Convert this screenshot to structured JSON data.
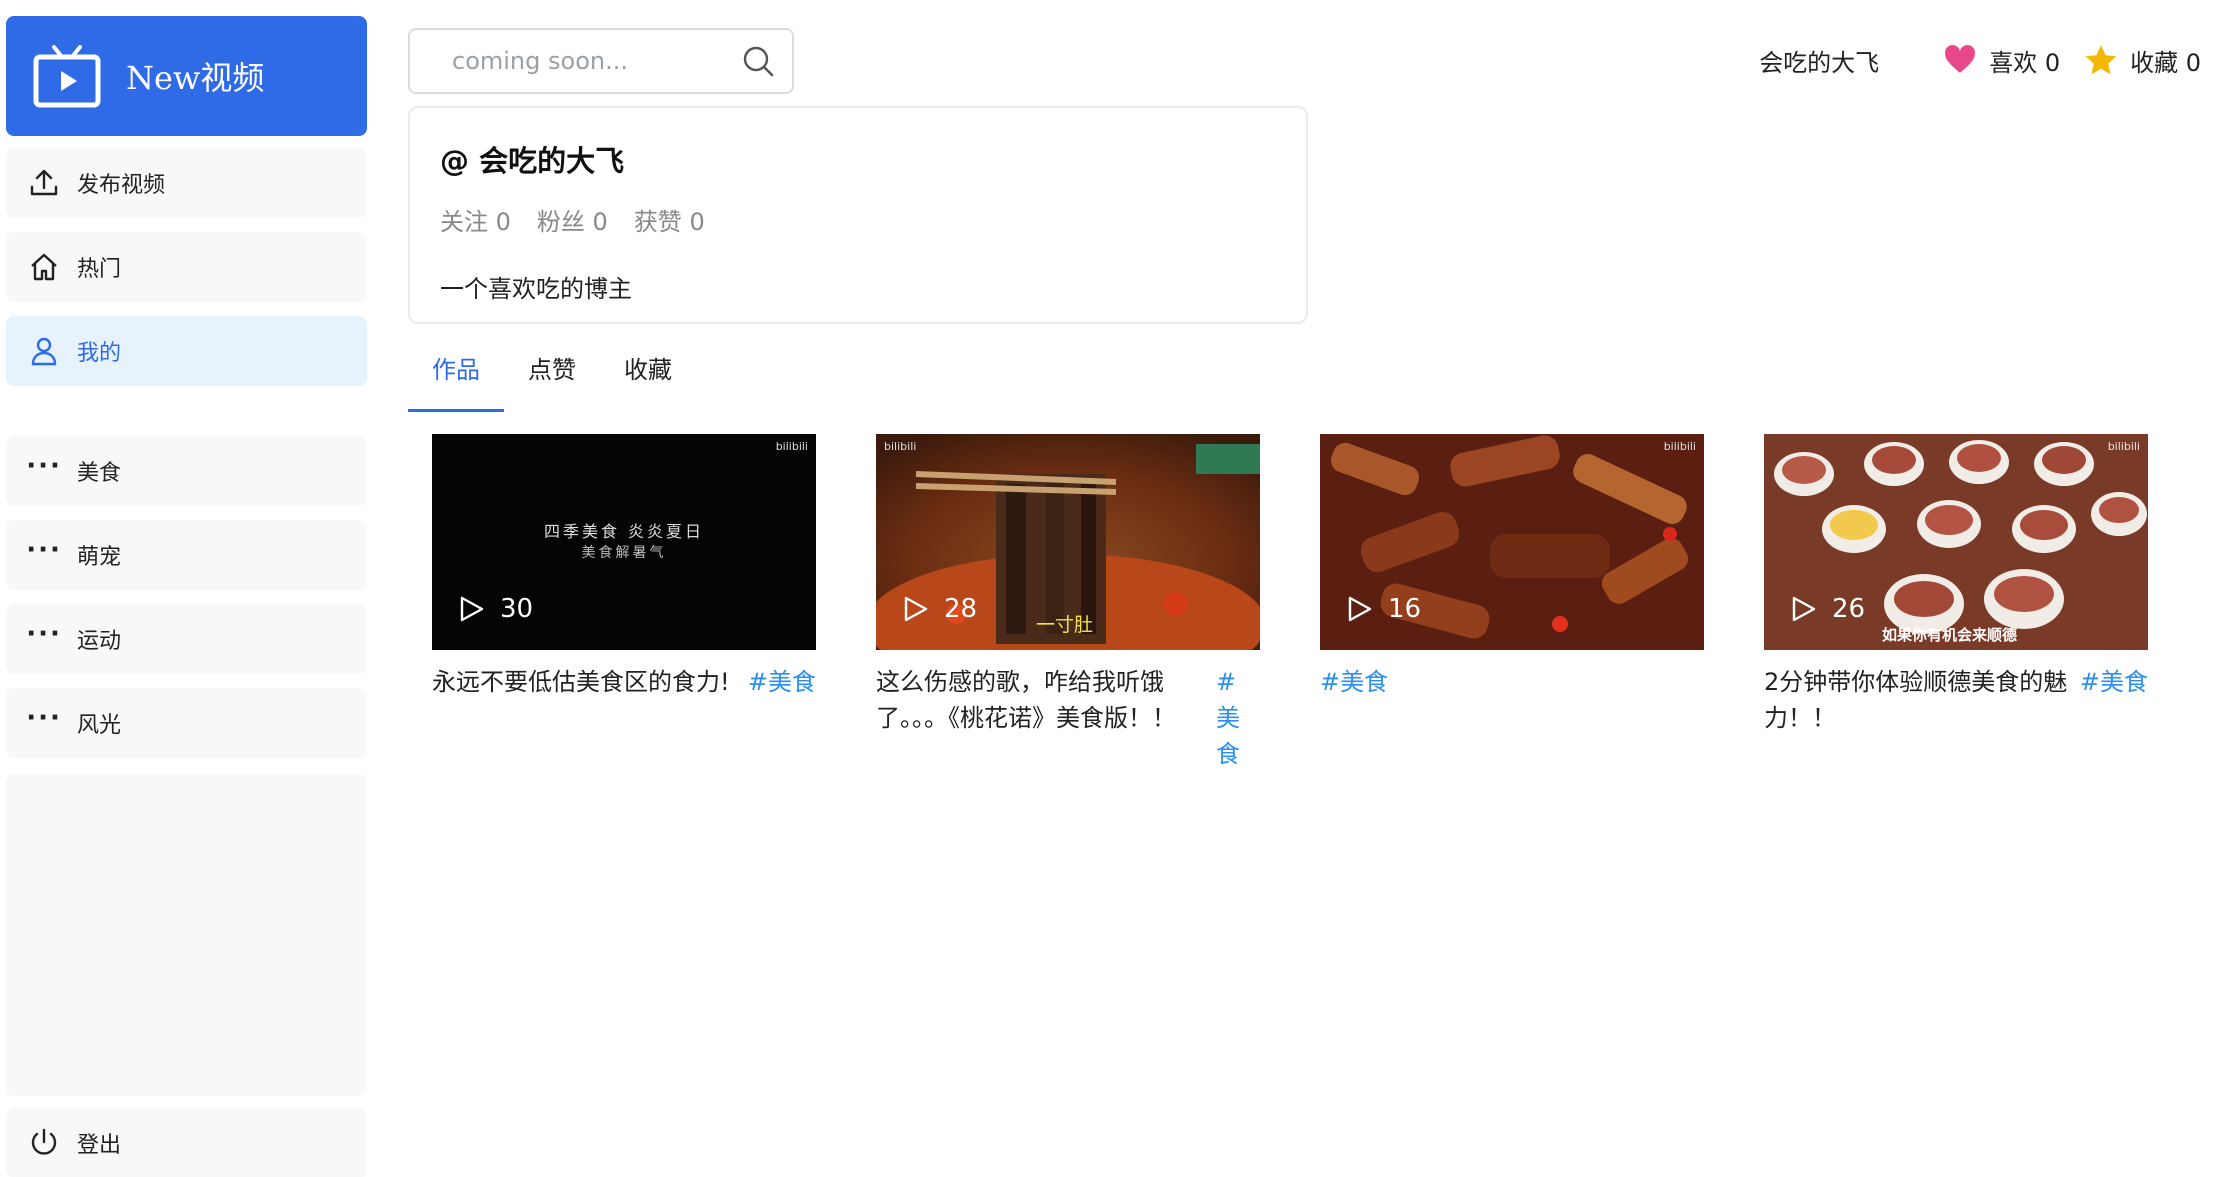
{
  "app": {
    "logo_text": "New视频"
  },
  "sidebar": {
    "items": [
      {
        "label": "发布视频",
        "icon": "upload-icon"
      },
      {
        "label": "热门",
        "icon": "home-icon"
      },
      {
        "label": "我的",
        "icon": "user-icon",
        "active": true
      }
    ],
    "categories": [
      {
        "label": "美食",
        "icon": "more-dots-icon"
      },
      {
        "label": "萌宠",
        "icon": "more-dots-icon"
      },
      {
        "label": "运动",
        "icon": "more-dots-icon"
      },
      {
        "label": "风光",
        "icon": "more-dots-icon"
      }
    ],
    "logout": {
      "label": "登出",
      "icon": "power-icon"
    }
  },
  "search": {
    "placeholder": "coming soon..."
  },
  "header": {
    "username": "会吃的大飞",
    "likes_label": "喜欢 0",
    "favorites_label": "收藏 0"
  },
  "profile": {
    "name": "@ 会吃的大飞",
    "following": "关注 0",
    "followers": "粉丝 0",
    "likes": "获赞 0",
    "bio": "一个喜欢吃的博主"
  },
  "tabs": [
    {
      "label": "作品",
      "active": true
    },
    {
      "label": "点赞"
    },
    {
      "label": "收藏"
    }
  ],
  "videos": [
    {
      "plays": "30",
      "title": "永远不要低估美食区的食力!",
      "tag": "#美食",
      "caption": "四季美食 炎炎夏日",
      "caption2": "美食解暑气"
    },
    {
      "plays": "28",
      "title": "这么伤感的歌，咋给我听饿了。。。《桃花诺》美食版！！",
      "tag": "#美食",
      "caption": "一寸肚"
    },
    {
      "plays": "16",
      "title": "",
      "tag": "#美食"
    },
    {
      "plays": "26",
      "title": "2分钟带你体验顺德美食的魅力！！",
      "tag": "#美食",
      "caption": "如果你有机会来顺德"
    }
  ],
  "colors": {
    "accent": "#2f6be6",
    "heart": "#e8488a",
    "star": "#f5b800",
    "tag": "#2a8ff0"
  }
}
